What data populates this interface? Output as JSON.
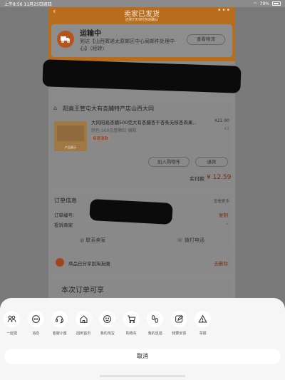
{
  "status_bar": {
    "time": "上午8:56",
    "date": "11月25日周四",
    "battery": "79%"
  },
  "header": {
    "title": "卖家已发货",
    "subtitle": "还剩7天9时自动确认"
  },
  "shipping": {
    "status": "运输中",
    "description": "到达【山西寄递太原邮区中心局邮件处理中心】（经转）",
    "button": "查看物流"
  },
  "shop": {
    "name": "阳高王管屯大有杏脯特产店山西大同"
  },
  "product": {
    "title": "大同阳高杏脯500克大有杏脯杏干杏条无核杏肉果…",
    "spec": "颜色:500克整颗粒 偏酸",
    "badge": "极速退款",
    "image_label": "产品展示",
    "price": "¥21.90",
    "qty": "x1",
    "add_cart": "加入购物车",
    "refund": "退款"
  },
  "payment": {
    "label": "实付款",
    "value": "¥ 12.59"
  },
  "order_info": {
    "title": "订单信息",
    "more": "查看更多",
    "order_no_label": "订单编号:",
    "copy": "复制",
    "complain": "投诉商家",
    "contact": "联系卖家",
    "call": "拨打电话"
  },
  "share": {
    "text": "商品已分享到淘友圈",
    "delete": "去删除"
  },
  "enjoy": {
    "title": "本次订单可享"
  },
  "sheet": {
    "items": [
      {
        "label": "一起逛",
        "icon": "group-icon"
      },
      {
        "label": "消息",
        "icon": "message-icon"
      },
      {
        "label": "客服小蜜",
        "icon": "headset-icon"
      },
      {
        "label": "回到首页",
        "icon": "home-icon"
      },
      {
        "label": "我的淘宝",
        "icon": "smile-icon"
      },
      {
        "label": "购物车",
        "icon": "cart-icon"
      },
      {
        "label": "我的足迹",
        "icon": "footprint-icon"
      },
      {
        "label": "我要反馈",
        "icon": "feedback-icon"
      },
      {
        "label": "举报",
        "icon": "warning-icon"
      }
    ],
    "cancel": "取消"
  }
}
